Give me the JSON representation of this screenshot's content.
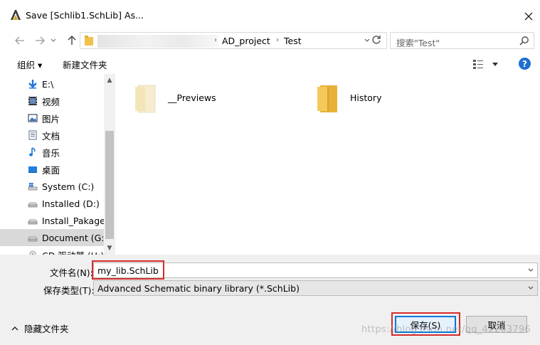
{
  "window": {
    "title": "Save [Schlib1.SchLib] As..."
  },
  "address": {
    "segments": [
      "AD_project",
      "Test"
    ]
  },
  "search": {
    "placeholder": "搜索\"Test\""
  },
  "toolbar": {
    "organize_label": "组织 ▾",
    "new_folder_label": "新建文件夹"
  },
  "nav_pane": {
    "items": [
      {
        "label": "E:\\",
        "icon": "download-arrow-icon"
      },
      {
        "label": "视频",
        "icon": "video-icon"
      },
      {
        "label": "图片",
        "icon": "picture-icon"
      },
      {
        "label": "文档",
        "icon": "document-icon"
      },
      {
        "label": "音乐",
        "icon": "music-note-icon"
      },
      {
        "label": "桌面",
        "icon": "desktop-icon"
      },
      {
        "label": "System (C:)",
        "icon": "system-drive-icon"
      },
      {
        "label": "Installed (D:)",
        "icon": "drive-icon"
      },
      {
        "label": "Install_Pakage (",
        "icon": "drive-icon"
      },
      {
        "label": "Document (G:)",
        "icon": "drive-icon",
        "selected": true
      },
      {
        "label": "CD 驱动器 (H:)",
        "icon": "cd-drive-icon"
      }
    ]
  },
  "content": {
    "folders": [
      {
        "name": "__Previews",
        "style": "faded"
      },
      {
        "name": "History",
        "style": "normal"
      }
    ]
  },
  "form": {
    "filename_label": "文件名(N):",
    "filename_value": "my_lib.SchLib",
    "filetype_label": "保存类型(T):",
    "filetype_value": "Advanced Schematic binary library (*.SchLib)"
  },
  "footer": {
    "hide_folders_label": "隐藏文件夹",
    "save_label": "保存(S)",
    "cancel_label": "取消",
    "watermark": "https://blog.csdn.net/qq_42263796"
  },
  "colors": {
    "accent": "#0078d7",
    "highlight_red": "#d52b2b",
    "folder_yellow": "#f0c24b",
    "help_blue": "#1e6fd0"
  }
}
